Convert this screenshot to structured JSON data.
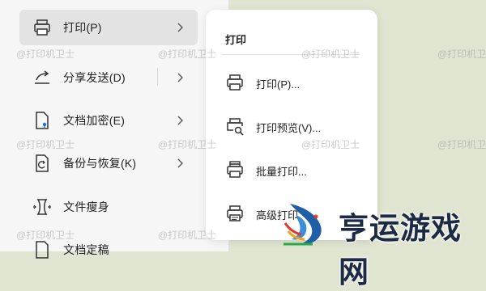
{
  "left_menu": {
    "items": [
      {
        "label": "打印(P)",
        "icon": "printer-icon",
        "has_arrow": true
      },
      {
        "label": "分享发送(D)",
        "icon": "share-icon",
        "has_arrow": true
      },
      {
        "label": "文档加密(E)",
        "icon": "lock-file-icon",
        "has_arrow": true
      },
      {
        "label": "备份与恢复(K)",
        "icon": "backup-icon",
        "has_arrow": true
      },
      {
        "label": "文件瘦身",
        "icon": "slim-icon",
        "has_arrow": false
      },
      {
        "label": "文档定稿",
        "icon": "finalize-icon",
        "has_arrow": false
      }
    ]
  },
  "submenu": {
    "title": "打印",
    "items": [
      {
        "label": "打印(P)...",
        "icon": "printer-icon"
      },
      {
        "label": "打印预览(V)...",
        "icon": "print-preview-icon"
      },
      {
        "label": "批量打印...",
        "icon": "batch-print-icon"
      },
      {
        "label": "高级打印",
        "icon": "advanced-print-icon"
      }
    ]
  },
  "watermark": "@打印机卫士",
  "brand": {
    "text": "亨运游戏网"
  }
}
